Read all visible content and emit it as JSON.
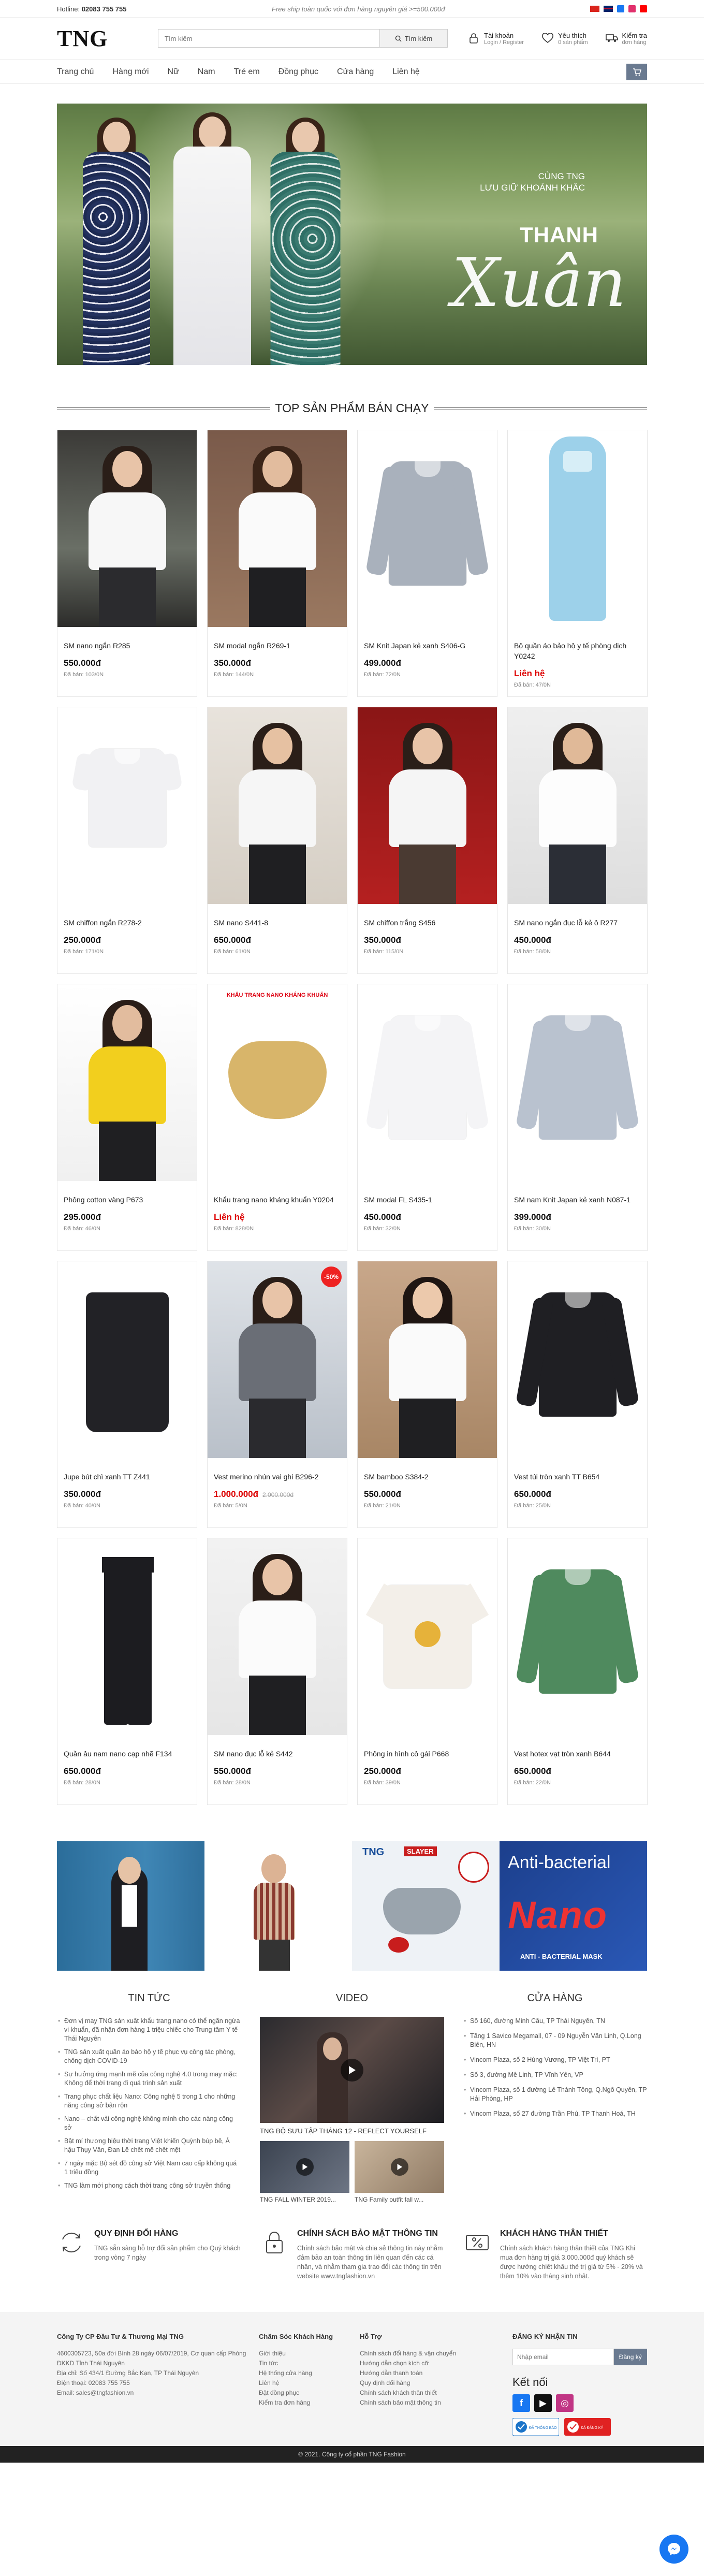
{
  "topbar": {
    "hotline_label": "Hotline:",
    "hotline_number": "02083 755 755",
    "freeship": "Free ship toàn quốc với đơn hàng nguyên giá >=500.000đ"
  },
  "header": {
    "logo": "TNG",
    "search_placeholder": "Tìm kiếm",
    "search_button": "Tìm kiếm",
    "account_title": "Tài khoản",
    "account_sub": "Login / Register",
    "wishlist_title": "Yêu thích",
    "wishlist_sub": "0 sản phẩm",
    "cart_title": "Kiểm tra",
    "cart_sub": "đơn hàng"
  },
  "nav": [
    "Trang chủ",
    "Hàng mới",
    "Nữ",
    "Nam",
    "Trẻ em",
    "Đồng phục",
    "Cửa hàng",
    "Liên hệ"
  ],
  "banner": {
    "line1": "CÙNG TNG",
    "line2": "LƯU GIỮ KHOẢNH KHẮC",
    "line3": "THANH",
    "line4": "Xuân"
  },
  "section_title": "TOP SẢN PHẨM BÁN CHẠY",
  "products": [
    {
      "name": "SM nano ngắn R285",
      "price": "550.000đ",
      "old": "",
      "sold": "Đã bán: 103/0N",
      "red": false,
      "sale": ""
    },
    {
      "name": "SM modal ngắn R269-1",
      "price": "350.000đ",
      "old": "",
      "sold": "Đã bán: 144/0N",
      "red": false,
      "sale": ""
    },
    {
      "name": "SM Knit Japan kẻ xanh S406-G",
      "price": "499.000đ",
      "old": "",
      "sold": "Đã bán: 72/0N",
      "red": false,
      "sale": ""
    },
    {
      "name": "Bộ quần áo bảo hộ y tế phòng dịch Y0242",
      "price": "Liên hệ",
      "old": "",
      "sold": "Đã bán: 47/0N",
      "red": true,
      "sale": ""
    },
    {
      "name": "SM chiffon ngắn R278-2",
      "price": "250.000đ",
      "old": "",
      "sold": "Đã bán: 171/0N",
      "red": false,
      "sale": ""
    },
    {
      "name": "SM nano S441-8",
      "price": "650.000đ",
      "old": "",
      "sold": "Đã bán: 61/0N",
      "red": false,
      "sale": ""
    },
    {
      "name": "SM chiffon trắng S456",
      "price": "350.000đ",
      "old": "",
      "sold": "Đã bán: 115/0N",
      "red": false,
      "sale": ""
    },
    {
      "name": "SM nano ngắn đục lỗ kẻ ô R277",
      "price": "450.000đ",
      "old": "",
      "sold": "Đã bán: 58/0N",
      "red": false,
      "sale": ""
    },
    {
      "name": "Phông cotton vàng P673",
      "price": "295.000đ",
      "old": "",
      "sold": "Đã bán: 46/0N",
      "red": false,
      "sale": ""
    },
    {
      "name": "Khẩu trang nano kháng khuẩn Y0204",
      "price": "Liên hệ",
      "old": "",
      "sold": "Đã bán: 828/0N",
      "red": true,
      "sale": ""
    },
    {
      "name": "SM modal FL S435-1",
      "price": "450.000đ",
      "old": "",
      "sold": "Đã bán: 32/0N",
      "red": false,
      "sale": ""
    },
    {
      "name": "SM nam Knit Japan kẻ xanh N087-1",
      "price": "399.000đ",
      "old": "",
      "sold": "Đã bán: 30/0N",
      "red": false,
      "sale": ""
    },
    {
      "name": "Jupe bút chì xanh TT Z441",
      "price": "350.000đ",
      "old": "",
      "sold": "Đã bán: 40/0N",
      "red": false,
      "sale": ""
    },
    {
      "name": "Vest merino nhún vai ghi B296-2",
      "price": "1.000.000đ",
      "old": "2.000.000đ",
      "sold": "Đã bán: 5/0N",
      "red": true,
      "sale": "-50%"
    },
    {
      "name": "SM bamboo S384-2",
      "price": "550.000đ",
      "old": "",
      "sold": "Đã bán: 21/0N",
      "red": false,
      "sale": ""
    },
    {
      "name": "Vest túi tròn xanh TT B654",
      "price": "650.000đ",
      "old": "",
      "sold": "Đã bán: 25/0N",
      "red": false,
      "sale": ""
    },
    {
      "name": "Quần âu nam nano cạp nhẽ F134",
      "price": "650.000đ",
      "old": "",
      "sold": "Đã bán: 28/0N",
      "red": false,
      "sale": ""
    },
    {
      "name": "SM nano đục lỗ kẻ S442",
      "price": "550.000đ",
      "old": "",
      "sold": "Đã bán: 28/0N",
      "red": false,
      "sale": ""
    },
    {
      "name": "Phông in hình cô gái P668",
      "price": "250.000đ",
      "old": "",
      "sold": "Đã bán: 39/0N",
      "red": false,
      "sale": ""
    },
    {
      "name": "Vest hotex vạt tròn xanh B644",
      "price": "650.000đ",
      "old": "",
      "sold": "Đã bán: 22/0N",
      "red": false,
      "sale": ""
    }
  ],
  "promo": {
    "slayer": "SLAYER",
    "antibac": "Anti-bacterial",
    "nano": "Nano",
    "mask_caption": "ANTI - BACTERIAL MASK",
    "brand": "TNG"
  },
  "news_title": "TIN TỨC",
  "news": [
    "Đơn vị may TNG sản xuất khẩu trang nano có thể ngăn ngừa vi khuẩn, đã nhận đơn hàng 1 triệu chiếc cho Trung tâm Y tế Thái Nguyên",
    "TNG sản xuất quần áo bảo hộ y tế phục vụ công tác phòng, chống dịch COVID-19",
    "Sự hưởng ứng mạnh mẽ của công nghệ 4.0 trong may mặc: Không để thời trang đi quá trình sản xuất",
    "Trang phục chất liệu Nano: Công nghệ 5 trong 1 cho những năng công sở bận rộn",
    "Nano – chất vải công nghệ không mình cho các nàng công sở",
    "Bật mí thương hiệu thời trang Việt khiến Quỳnh búp bê, Á hậu Thụy Vân, Đan Lê chết mê chết mệt",
    "7 ngày mặc Bộ sét đồ công sở Việt Nam cao cấp không quá 1 triệu đồng",
    "TNG làm mới phong cách thời trang công sở truyền thống"
  ],
  "video_title": "VIDEO",
  "video": {
    "main_caption": "TNG BỘ SƯU TẬP THÁNG 12 - REFLECT YOURSELF",
    "thumb1": "TNG FALL WINTER 2019...",
    "thumb2": "TNG Family outfit fall w..."
  },
  "stores_title": "CỬA HÀNG",
  "stores": [
    "Số 160, đường Minh Cầu, TP Thái Nguyên, TN",
    "Tầng 1 Savico Megamall, 07 - 09 Nguyễn Văn Linh, Q.Long Biên, HN",
    "Vincom Plaza, số 2 Hùng Vương, TP Việt Trì, PT",
    "Số 3, đường Mê Linh, TP Vĩnh Yên, VP",
    "Vincom Plaza, số 1 đường Lê Thánh Tông, Q.Ngô Quyền, TP Hải Phòng, HP",
    "Vincom Plaza, số 27 đường Trần Phú, TP Thanh Hoá, TH"
  ],
  "policies": [
    {
      "title": "QUY ĐỊNH ĐỔI HÀNG",
      "text": "TNG sẵn sàng hỗ trợ đổi sản phẩm cho Quý khách trong vòng 7 ngày"
    },
    {
      "title": "CHÍNH SÁCH BẢO MẬT THÔNG TIN",
      "text": "Chính sách bảo mật và chia sẻ thông tin này nhằm đảm bảo an toàn thông tin liên quan đến các cá nhân, và nhằm tham gia trao đổi các thông tin trên website www.tngfashion.vn"
    },
    {
      "title": "KHÁCH HÀNG THÂN THIẾT",
      "text": "Chính sách khách hàng thân thiết của TNG Khi mua đơn hàng trị giá 3.000.000đ quý khách sẽ được hưởng chiết khấu thẻ trị giá từ 5% - 20% và thêm 10% vào tháng sinh nhật."
    }
  ],
  "footer": {
    "company": "Công Ty CP Đầu Tư & Thương Mại TNG",
    "company_lines": [
      "4600305723, 50a đời Bình 28 ngày 06/07/2019, Cơ quan cấp Phòng ĐKKD Tỉnh Thái Nguyên",
      "Địa chỉ: Số 434/1 Đường Bắc Kạn, TP Thái Nguyên",
      "Điện thoại: 02083 755 755",
      "Email: sales@tngfashion.vn"
    ],
    "care_title": "Chăm Sóc Khách Hàng",
    "care": [
      "Giới thiệu",
      "Tin tức",
      "Hệ thống cửa hàng",
      "Liên hệ",
      "Đặt đồng phục",
      "Kiểm tra đơn hàng"
    ],
    "support_title": "Hỗ Trợ",
    "support": [
      "Chính sách đổi hàng & vận chuyển",
      "Hướng dẫn chọn kích cỡ",
      "Hướng dẫn thanh toán",
      "Quy định đổi hàng",
      "Chính sách khách thân thiết",
      "Chính sách bảo mật thông tin"
    ],
    "sub_title": "ĐĂNG KÝ NHẬN TIN",
    "sub_placeholder": "Nhập email",
    "sub_button": "Đăng ký",
    "connect": "Kết nối",
    "badge1": "ĐÃ THÔNG BÁO",
    "badge2": "ĐÃ ĐĂNG KÝ",
    "copyright": "© 2021. Công ty cổ phần TNG Fashion"
  }
}
